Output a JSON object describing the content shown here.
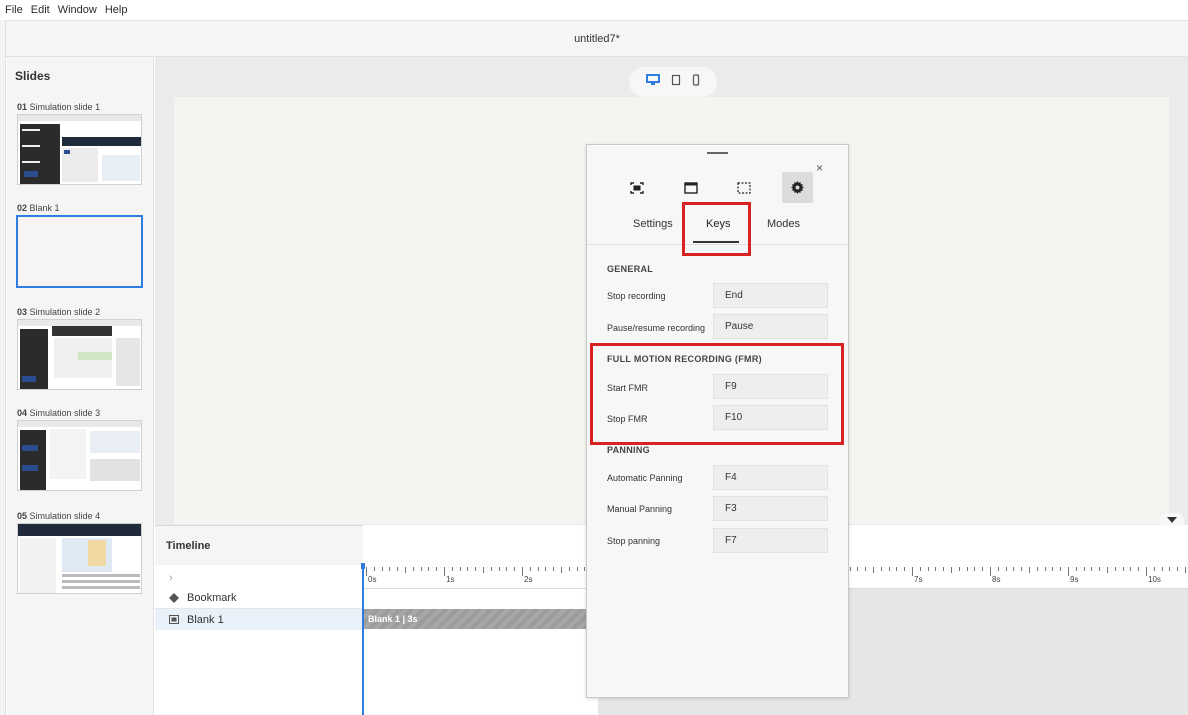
{
  "menu": [
    "File",
    "Edit",
    "Window",
    "Help"
  ],
  "document_title": "untitled7*",
  "slides_panel": {
    "title": "Slides",
    "items": [
      {
        "num": "01",
        "label": "Simulation slide 1"
      },
      {
        "num": "02",
        "label": "Blank 1"
      },
      {
        "num": "03",
        "label": "Simulation slide 2"
      },
      {
        "num": "04",
        "label": "Simulation slide 3"
      },
      {
        "num": "05",
        "label": "Simulation slide 4"
      }
    ]
  },
  "device_toggle": {
    "icons": [
      "desktop-icon",
      "tablet-icon",
      "phone-icon"
    ],
    "selected": "desktop-icon"
  },
  "timeline": {
    "title": "Timeline",
    "expand": "›",
    "rows": [
      {
        "icon": "bookmark-diamond-icon",
        "label": "Bookmark"
      },
      {
        "icon": "slide-icon",
        "label": "Blank 1"
      }
    ],
    "ticks": [
      "0s",
      "1s",
      "2s",
      "7s",
      "8s",
      "9s",
      "10s"
    ],
    "clip_label": "Blank 1 | 3s"
  },
  "recording_panel": {
    "close": "×",
    "mode_icons": [
      "full-screen-capture-icon",
      "application-window-icon",
      "custom-area-icon",
      "gear-icon"
    ],
    "tabs": [
      {
        "label": "Settings",
        "active": false
      },
      {
        "label": "Keys",
        "active": true
      },
      {
        "label": "Modes",
        "active": false
      }
    ],
    "sections": [
      {
        "heading": "GENERAL",
        "rows": [
          {
            "label": "Stop recording",
            "key": "End"
          },
          {
            "label": "Pause/resume recording",
            "key": "Pause"
          }
        ]
      },
      {
        "heading": "FULL MOTION RECORDING (FMR)",
        "rows": [
          {
            "label": "Start FMR",
            "key": "F9"
          },
          {
            "label": "Stop FMR",
            "key": "F10"
          }
        ]
      },
      {
        "heading": "PANNING",
        "rows": [
          {
            "label": "Automatic Panning",
            "key": "F4"
          },
          {
            "label": "Manual Panning",
            "key": "F3"
          },
          {
            "label": "Stop panning",
            "key": "F7"
          }
        ]
      }
    ]
  },
  "colors": {
    "accent": "#2f7de1",
    "highlight": "#d92323"
  }
}
